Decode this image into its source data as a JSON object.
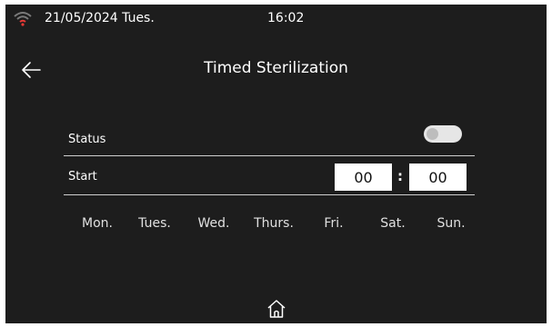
{
  "status_bar": {
    "date": "21/05/2024 Tues.",
    "time": "16:02",
    "wifi_icon": "wifi-icon",
    "wifi_color": "#e53935"
  },
  "header": {
    "title": "Timed Sterilization",
    "back_icon": "arrow-left-icon"
  },
  "settings": {
    "status_label": "Status",
    "status_enabled": false,
    "start_label": "Start",
    "start_hour": "00",
    "start_minute": "00",
    "separator": ":"
  },
  "days": [
    "Mon.",
    "Tues.",
    "Wed.",
    "Thurs.",
    "Fri.",
    "Sat.",
    "Sun."
  ],
  "footer": {
    "home_icon": "home-icon"
  },
  "colors": {
    "background": "#1d1d1d",
    "text": "#ffffff",
    "toggle_off": "#e6e6e6"
  }
}
